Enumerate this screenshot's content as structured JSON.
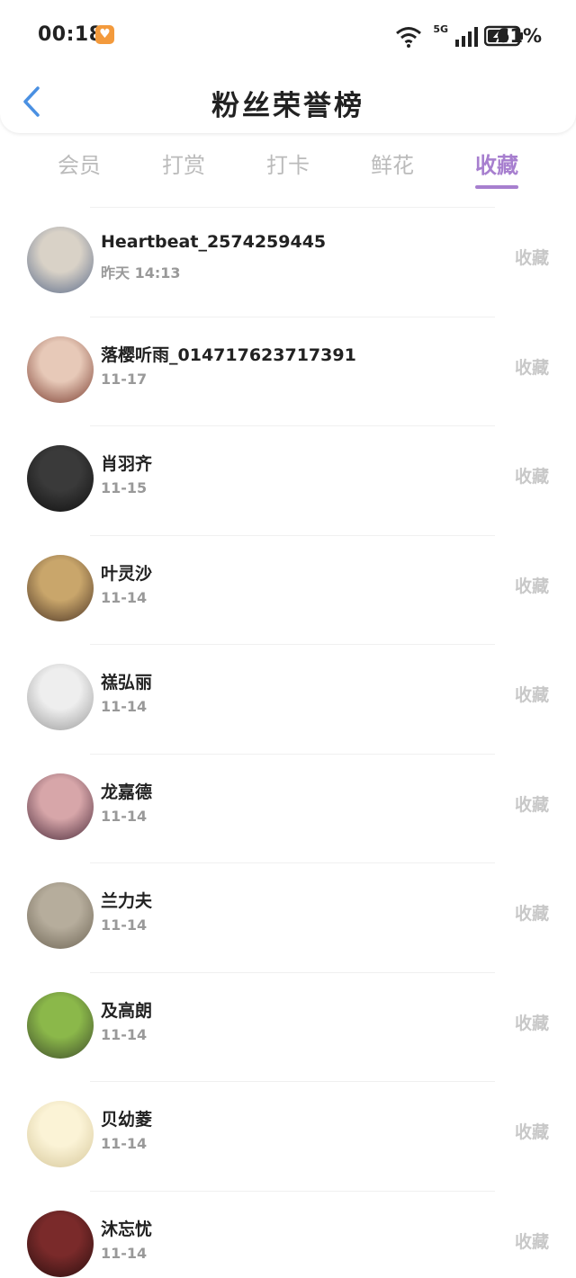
{
  "status_bar": {
    "time": "00:18",
    "badge_icon": "heart-app-icon",
    "network_label": "5G",
    "battery": "61%",
    "icons": [
      "wifi-icon",
      "signal-icon",
      "battery-icon"
    ]
  },
  "header": {
    "title": "粉丝荣誉榜",
    "back_icon": "chevron-left-icon"
  },
  "colors": {
    "accent": "#a77fcf",
    "tab_inactive": "#bbbbbb",
    "action_text": "#c8c8c8",
    "back_icon": "#4a90e2"
  },
  "tabs": [
    {
      "label": "会员",
      "active": false
    },
    {
      "label": "打赏",
      "active": false
    },
    {
      "label": "打卡",
      "active": false
    },
    {
      "label": "鲜花",
      "active": false
    },
    {
      "label": "收藏",
      "active": true
    }
  ],
  "fans": [
    {
      "name": "Heartbeat_2574259445",
      "date": "昨天 14:13",
      "action": "收藏",
      "avatar_colors": [
        "#d9d2c7",
        "#5b6b8a"
      ]
    },
    {
      "name": "落樱听雨_014717623717391",
      "date": "11-17",
      "action": "收藏",
      "avatar_colors": [
        "#e7c9b8",
        "#7a3b2e"
      ]
    },
    {
      "name": "肖羽齐",
      "date": "11-15",
      "action": "收藏",
      "avatar_colors": [
        "#3a3a3a",
        "#0f0f0f"
      ]
    },
    {
      "name": "叶灵沙",
      "date": "11-14",
      "action": "收藏",
      "avatar_colors": [
        "#c9a66b",
        "#4b3424"
      ]
    },
    {
      "name": "禚弘丽",
      "date": "11-14",
      "action": "收藏",
      "avatar_colors": [
        "#eeeeee",
        "#9a9a9a"
      ]
    },
    {
      "name": "龙嘉德",
      "date": "11-14",
      "action": "收藏",
      "avatar_colors": [
        "#d7a6a9",
        "#4a2a3a"
      ]
    },
    {
      "name": "兰力夫",
      "date": "11-14",
      "action": "收藏",
      "avatar_colors": [
        "#b6ad9c",
        "#6d6454"
      ]
    },
    {
      "name": "及高朗",
      "date": "11-14",
      "action": "收藏",
      "avatar_colors": [
        "#8bb84a",
        "#3d4a2a"
      ]
    },
    {
      "name": "贝幼菱",
      "date": "11-14",
      "action": "收藏",
      "avatar_colors": [
        "#fbf3d6",
        "#d6c79a"
      ]
    },
    {
      "name": "沐忘忧",
      "date": "11-14",
      "action": "收藏",
      "avatar_colors": [
        "#7a2a2a",
        "#2a0f0f"
      ]
    }
  ]
}
